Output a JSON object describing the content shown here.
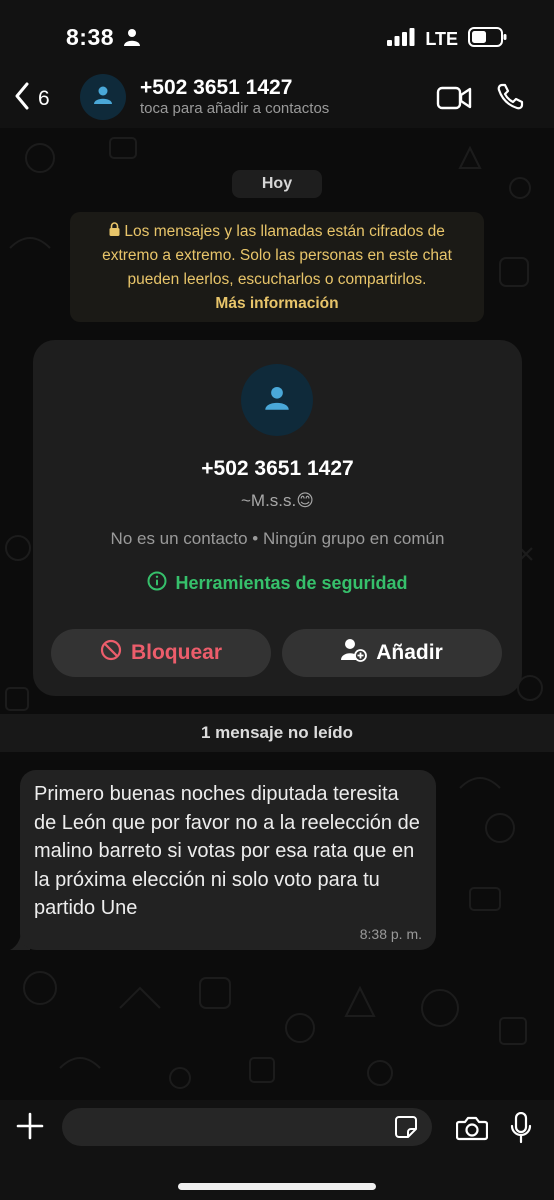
{
  "status_bar": {
    "time": "8:38",
    "network": "LTE",
    "icons": [
      "person-icon",
      "signal-icon",
      "battery-icon"
    ]
  },
  "header": {
    "back_count": "6",
    "contact_name": "+502 3651 1427",
    "subtitle": "toca para añadir a contactos",
    "icons": [
      "back-chevron-icon",
      "avatar-icon",
      "video-call-icon",
      "phone-icon"
    ]
  },
  "chat": {
    "date_label": "Hoy",
    "encryption_notice": "Los mensajes y las llamadas están cifrados de extremo a extremo. Solo las personas en este chat pueden leerlos, escucharlos o compartirlos.",
    "encryption_link": "Más información",
    "contact_card": {
      "number": "+502 3651 1427",
      "alias": "~M.s.s.😊",
      "note": "No es un contacto • Ningún grupo en común",
      "security_tools": "Herramientas de seguridad",
      "block_label": "Bloquear",
      "add_label": "Añadir"
    },
    "unread_label": "1 mensaje no leído",
    "messages": [
      {
        "text": "Primero buenas noches diputada teresita de León que por favor no a la reelección de malino barreto si votas por esa rata que en la próxima elección ni solo voto para tu partido Une",
        "time": "8:38 p. m."
      }
    ]
  },
  "composer": {
    "placeholder": "",
    "icons": [
      "plus-icon",
      "sticker-icon",
      "camera-icon",
      "microphone-icon"
    ]
  },
  "colors": {
    "header_bg": "#121212",
    "chat_bg": "#0c0c0c",
    "encryption_text": "#e8c56a",
    "danger": "#ec5d6b",
    "security_green": "#36c06b",
    "bubble_bg": "#222222"
  }
}
